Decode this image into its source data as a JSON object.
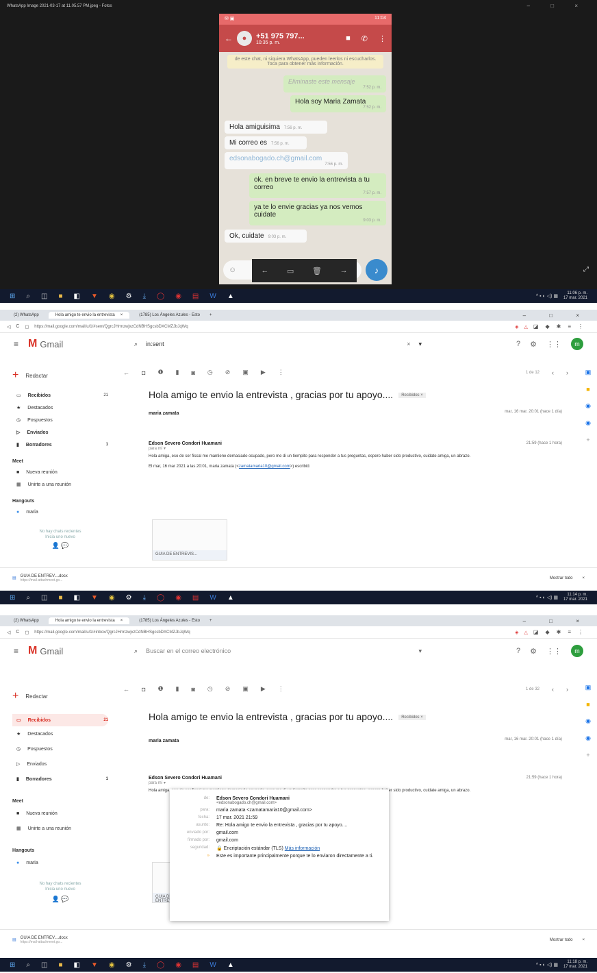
{
  "viewer": {
    "title": "WhatsApp Image 2021-03-17 at 11.05.57 PM.jpeg - Fotos",
    "controls": "–  □  ×",
    "expand_glyph": "⤢",
    "phone": {
      "time": "11:04",
      "contact": "+51 975 797...",
      "last_seen": "10:35 p. m.",
      "encryption_notice": "de este chat, ni siquiera WhatsApp, pueden leerlos ni escucharlos. Toca para obtener más información.",
      "messages": [
        {
          "dir": "out",
          "text": "Eliminaste este mensaje",
          "time": "7:52 p. m.",
          "deleted": true
        },
        {
          "dir": "out",
          "text": "Hola soy Maria Zamata",
          "time": "7:52 p. m."
        },
        {
          "dir": "in",
          "text": "Hola amiguisima",
          "time": "7:56 p. m."
        },
        {
          "dir": "in",
          "text": "Mi correo es",
          "time": "7:56 p. m."
        },
        {
          "dir": "in",
          "text": "edsonabogado.ch@gmail.com",
          "time": "7:56 p. m.",
          "link": true
        },
        {
          "dir": "out",
          "text": "ok. en breve te envio la entrevista a tu correo",
          "time": "7:57 p. m."
        },
        {
          "dir": "out",
          "text": "ya te lo envie gracias ya nos vemos cuidate",
          "time": "9:03 p. m."
        },
        {
          "dir": "in",
          "text": "Ok, cuidate",
          "time": "9:03 p. m."
        }
      ]
    }
  },
  "taskbars": [
    {
      "time": "11:06 p. m.",
      "date": "17 mar. 2021"
    },
    {
      "time": "11:14 p. m.",
      "date": "17 mar. 2021"
    },
    {
      "time": "11:18 p. m.",
      "date": "17 mar. 2021"
    }
  ],
  "gmail1": {
    "tabs": [
      "(2) WhatsApp",
      "Hola amigo te envio la entrevista",
      "(1785) Los Ángeles Azules - Esto"
    ],
    "url": "https://mail.google.com/mail/u/1/#sent/QgrcJHrmzwjxzCdNBHSgcsbDXCMZJbJqWq",
    "search_value": "in:sent",
    "pager": "1 de 12",
    "subject": "Hola amigo te envio la entrevista , gracias por tu apoyo....",
    "label": "Recibidos ×",
    "msg1_sender": "maria zamata",
    "msg1_date": "mar, 16 mar. 20:01 (hace 1 día)",
    "msg2_sender": "Edson Severo Condori Huamani",
    "msg2_to": "para mí ▾",
    "msg2_date": "21:59 (hace 1 hora)",
    "body": "Hola amiga, eso de ser fiscal me mantiene demasiado ocupado, pero me di un tiempito para responder a tus preguntas, espero haber sido productivo, cuidate amiga, un abrazo.",
    "quote_prefix": "El mar, 16 mar 2021 a las 20:01, maria zamata (<",
    "quote_email": "zamatamaria10@gmail.com",
    "quote_suffix": ">) escribió:",
    "attachment": "GUIA DE ENTREVIS..."
  },
  "gmail2": {
    "url": "https://mail.google.com/mail/u/1/#inbox/QgrcJHrmzwjxzCdNBHSgcsbDXCMZJbJqWq",
    "search_placeholder": "Buscar en el correo electrónico",
    "pager": "1 de 32",
    "popup": {
      "de_label": "de:",
      "de_name": "Edson Severo Condori Huamani",
      "de_email": "<edsonabogado.ch@gmail.com>",
      "para_label": "para:",
      "para": "maria zamata <zamatamaria10@gmail.com>",
      "fecha_label": "fecha:",
      "fecha": "17 mar. 2021 21:59",
      "asunto_label": "asunto:",
      "asunto": "Re: Hola amigo te envio la entrevista , gracias por tu apoyo....",
      "enviado_label": "enviado por:",
      "enviado": "gmail.com",
      "firmado_label": "firmado por:",
      "firmado": "gmail.com",
      "seguridad_label": "seguridad:",
      "seguridad": "Encriptación estándar (TLS)",
      "mas_info": "Más información",
      "importance": "Este es importante principalmente porque te lo enviaron directamente a ti."
    }
  },
  "sidebar": {
    "compose": "Redactar",
    "items": [
      {
        "label": "Recibidos",
        "count": "21"
      },
      {
        "label": "Destacados",
        "count": ""
      },
      {
        "label": "Pospuestos",
        "count": ""
      },
      {
        "label": "Enviados",
        "count": ""
      },
      {
        "label": "Borradores",
        "count": "1"
      }
    ],
    "meet": "Meet",
    "new_meeting": "Nueva reunión",
    "join_meeting": "Unirte a una reunión",
    "hangouts": "Hangouts",
    "contact": "maria",
    "no_chats": "No hay chats recientes",
    "start_new": "Inicia uno nuevo"
  },
  "download": {
    "file": "GUIA DE ENTREV....docx",
    "sub": "https://mail-attachment.go...",
    "show_all": "Mostrar todo"
  }
}
